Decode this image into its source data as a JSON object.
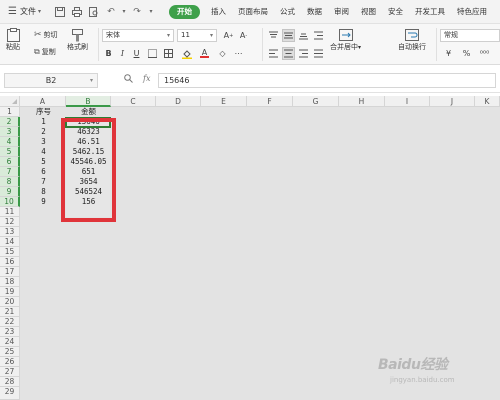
{
  "menubar": {
    "file_label": "文件",
    "tabs": [
      "开始",
      "插入",
      "页面布局",
      "公式",
      "数据",
      "审阅",
      "视图",
      "安全",
      "开发工具",
      "特色应用"
    ],
    "active_tab": "开始"
  },
  "ribbon": {
    "paste": "粘贴",
    "cut": "剪切",
    "copy": "复制",
    "format_painter": "格式刷",
    "font_name": "宋体",
    "font_size": "11",
    "merge_center": "合并居中",
    "wrap_text": "自动换行",
    "number_format": "常规",
    "currency": "¥",
    "percent": "%"
  },
  "formula_bar": {
    "name_box": "B2",
    "fx": "fx",
    "content": "15646"
  },
  "sheet": {
    "columns": [
      "A",
      "B",
      "C",
      "D",
      "E",
      "F",
      "G",
      "H",
      "I",
      "J",
      "K"
    ],
    "rows": [
      "1",
      "2",
      "3",
      "4",
      "5",
      "6",
      "7",
      "8",
      "9",
      "10",
      "11",
      "12",
      "13",
      "14",
      "15",
      "16",
      "17",
      "18",
      "19",
      "20",
      "21",
      "22",
      "23",
      "24",
      "25",
      "26",
      "27",
      "28",
      "29"
    ],
    "header_a": "序号",
    "header_b": "金额",
    "data": [
      {
        "a": "1",
        "b": "15646"
      },
      {
        "a": "2",
        "b": "46323"
      },
      {
        "a": "3",
        "b": "46.51"
      },
      {
        "a": "4",
        "b": "5462.15"
      },
      {
        "a": "5",
        "b": "45546.05"
      },
      {
        "a": "6",
        "b": "651"
      },
      {
        "a": "7",
        "b": "3654"
      },
      {
        "a": "8",
        "b": "546524"
      },
      {
        "a": "9",
        "b": "156"
      }
    ]
  },
  "colors": {
    "accent_green": "#3ea04a",
    "highlight_red": "#e0343a"
  },
  "watermark": {
    "main": "Baidu经验",
    "sub": "jingyan.baidu.com"
  }
}
